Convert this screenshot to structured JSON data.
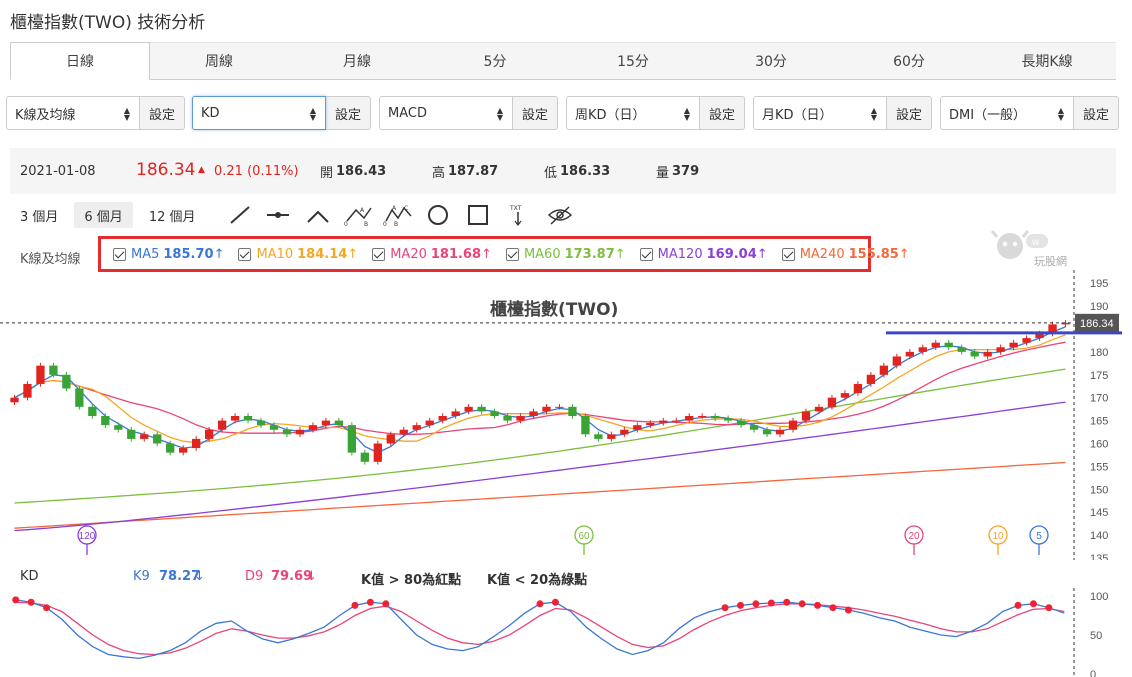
{
  "page_title": "櫃檯指數(TWO) 技術分析",
  "tabs": [
    "日線",
    "周線",
    "月線",
    "5分",
    "15分",
    "30分",
    "60分",
    "長期K線"
  ],
  "active_tab": 0,
  "selectors": [
    {
      "value": "K線及均線",
      "button": "設定"
    },
    {
      "value": "KD",
      "button": "設定"
    },
    {
      "value": "MACD",
      "button": "設定"
    },
    {
      "value": "周KD（日）",
      "button": "設定"
    },
    {
      "value": "月KD（日）",
      "button": "設定"
    },
    {
      "value": "DMI（一般）",
      "button": "設定"
    }
  ],
  "info": {
    "date": "2021-01-08",
    "price": "186.34",
    "change": "0.21 (0.11%)",
    "open_label": "開",
    "open": "186.43",
    "high_label": "高",
    "high": "187.87",
    "low_label": "低",
    "low": "186.33",
    "vol_label": "量",
    "vol": "379"
  },
  "ranges": [
    "3 個月",
    "6 個月",
    "12 個月"
  ],
  "active_range": 1,
  "tools": [
    "line-tool-icon",
    "horizontal-line-tool-icon",
    "angle-tool-icon",
    "abc-pattern-tool-icon",
    "abcd-pattern-tool-icon",
    "circle-tool-icon",
    "rectangle-tool-icon",
    "text-tool-icon",
    "hide-drawings-icon"
  ],
  "ma_section_label": "K線及均線",
  "ma_items": [
    {
      "name": "MA5",
      "value": "185.70",
      "arrow": "↑",
      "color": "#3a78d6"
    },
    {
      "name": "MA10",
      "value": "184.14",
      "arrow": "↑",
      "color": "#f5a623"
    },
    {
      "name": "MA20",
      "value": "181.68",
      "arrow": "↑",
      "color": "#e8457a"
    },
    {
      "name": "MA60",
      "value": "173.87",
      "arrow": "↑",
      "color": "#7cbf3f"
    },
    {
      "name": "MA120",
      "value": "169.04",
      "arrow": "↑",
      "color": "#8a3fd8"
    },
    {
      "name": "MA240",
      "value": "155.85",
      "arrow": "↑",
      "color": "#f4683a"
    }
  ],
  "logo_text": "玩股網",
  "chart_data": {
    "type": "candlestick",
    "title": "櫃檯指數(TWO)",
    "ylim": [
      135,
      197
    ],
    "y_ticks": [
      135,
      140,
      145,
      150,
      155,
      160,
      165,
      170,
      175,
      180,
      185,
      190,
      195
    ],
    "current_price_label": "186.34",
    "ma_period_markers": [
      "120",
      "60",
      "20",
      "10",
      "5"
    ],
    "close_series": [
      170,
      173,
      177,
      175,
      172,
      168,
      166,
      164,
      163,
      161,
      162,
      160,
      158,
      159,
      161,
      163,
      165,
      166,
      165,
      164,
      163,
      162,
      163,
      164,
      165,
      164,
      158,
      156,
      160,
      162,
      163,
      164,
      165,
      166,
      167,
      168,
      167,
      166,
      165,
      166,
      167,
      168,
      168,
      166,
      162,
      161,
      162,
      163,
      164,
      164.5,
      165,
      165,
      166,
      166,
      165.5,
      165,
      164,
      163,
      162,
      163,
      165,
      167,
      168,
      170,
      171,
      173,
      175,
      177,
      179,
      180,
      181,
      182,
      181,
      180,
      179,
      180,
      181,
      182,
      183,
      184,
      186,
      186.34
    ],
    "kd": {
      "label": "KD",
      "k_label": "K9",
      "k_value": "78.27",
      "k_arrow": "↓",
      "k_color": "#3a78d6",
      "d_label": "D9",
      "d_value": "79.69",
      "d_arrow": "↓",
      "d_color": "#e8457a",
      "note1": "K值 > 80為紅點",
      "note2": "K值 < 20為綠點",
      "ylim": [
        0,
        100
      ],
      "y_ticks": [
        0,
        50,
        100
      ],
      "k_series": [
        95,
        92,
        85,
        70,
        50,
        35,
        25,
        22,
        20,
        24,
        30,
        40,
        55,
        65,
        68,
        55,
        45,
        40,
        45,
        52,
        60,
        75,
        88,
        92,
        90,
        70,
        50,
        38,
        32,
        30,
        35,
        48,
        62,
        78,
        90,
        92,
        80,
        60,
        45,
        32,
        25,
        30,
        40,
        58,
        72,
        80,
        85,
        88,
        90,
        91,
        92,
        90,
        88,
        85,
        82,
        78,
        72,
        68,
        60,
        55,
        50,
        48,
        55,
        65,
        80,
        88,
        90,
        85,
        78
      ],
      "d_series": [
        92,
        91,
        88,
        80,
        65,
        50,
        38,
        30,
        26,
        25,
        27,
        33,
        42,
        52,
        58,
        55,
        50,
        46,
        46,
        49,
        54,
        63,
        75,
        84,
        87,
        80,
        68,
        56,
        46,
        40,
        38,
        42,
        50,
        62,
        75,
        84,
        82,
        72,
        60,
        48,
        38,
        34,
        36,
        45,
        57,
        67,
        75,
        81,
        85,
        88,
        90,
        90,
        89,
        87,
        85,
        82,
        78,
        74,
        69,
        64,
        58,
        54,
        54,
        58,
        67,
        76,
        83,
        84,
        80
      ]
    }
  }
}
